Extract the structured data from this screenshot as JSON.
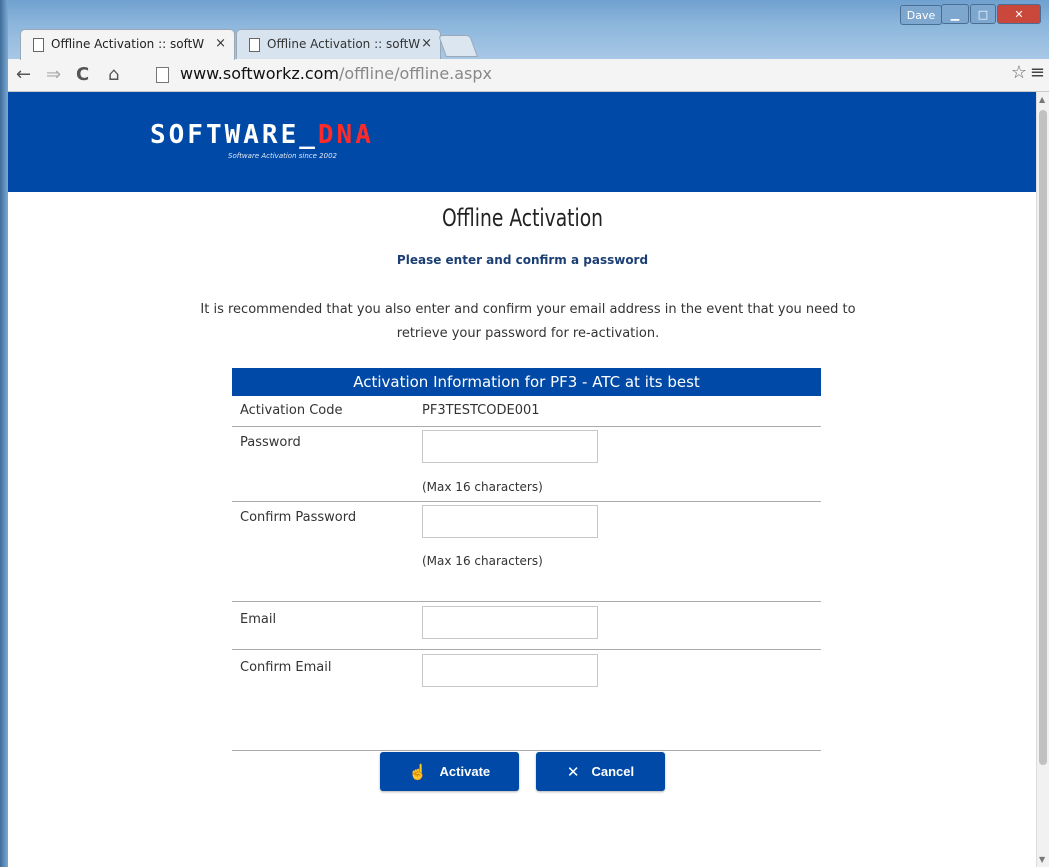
{
  "browser": {
    "tabs": [
      {
        "label": "Offline Activation :: softW",
        "active": true
      },
      {
        "label": "Offline Activation :: softW",
        "active": false
      }
    ],
    "user": "Dave",
    "url_host": "www.softworkz.com",
    "url_path": "/offline/offline.aspx"
  },
  "header": {
    "logo_main": "SOFTWARE_",
    "logo_accent": "DNA",
    "tagline": "Software Activation since 2002"
  },
  "page": {
    "title": "Offline Activation",
    "subtitle": "Please enter and confirm a password",
    "notice_line1": "It is recommended that you also enter and confirm your email address in the event that you need to",
    "notice_line2": "retrieve your password for re-activation."
  },
  "form": {
    "header": "Activation Information for PF3 - ATC at its best",
    "activation_code_label": "Activation Code",
    "activation_code_value": "PF3TESTCODE001",
    "password_label": "Password",
    "password_hint": "(Max 16 characters)",
    "confirm_password_label": "Confirm Password",
    "confirm_password_hint": "(Max 16 characters)",
    "email_label": "Email",
    "confirm_email_label": "Confirm Email"
  },
  "buttons": {
    "activate": "Activate",
    "cancel": "Cancel"
  },
  "icons": {
    "activate": "thumb-up-icon",
    "cancel": "close-icon"
  },
  "colors": {
    "brand_blue": "#0049a6",
    "accent_red": "#ff2a2a"
  }
}
